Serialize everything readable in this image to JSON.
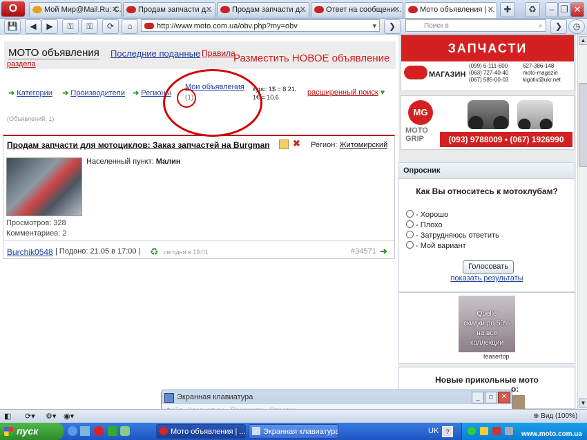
{
  "browser": {
    "tabs": [
      {
        "label": "Мой Мир@Mail.Ru: С..."
      },
      {
        "label": "Продам запчасти д..."
      },
      {
        "label": "Продам запчасти д..."
      },
      {
        "label": "Ответ на сообщени..."
      },
      {
        "label": "Мото объявления | ..."
      }
    ],
    "url": "http://www.moto.com.ua/obv.php?my=obv",
    "search_placeholder": "Поиск в",
    "zoom": "Вид (100%)"
  },
  "page": {
    "site_title": "МОТО объявления",
    "nav_recent": "Последние поданные",
    "nav_rules_1": "Правила",
    "nav_rules_2": "раздела",
    "post_new": "Разместить НОВОЕ объявление",
    "menu": {
      "categories": "Категории",
      "manufacturers": "Производители",
      "regions": "Регионы",
      "my_ads": "Мои объявления",
      "my_ads_count": "(1)",
      "rate": "курс: 1$ = 8.21,",
      "rate2": "1€ = 10.6",
      "advanced_search": "расширенный поиск"
    },
    "ads_count": "(Объявлений: 1)",
    "post": {
      "title": "Продам запчасти для мотоциклов: Заказ запчастей на Burgman",
      "region_label": "Регион:",
      "region": "Житомирский",
      "locality_label": "Населенный пункт:",
      "locality": "Малин",
      "views": "Просмотров: 328",
      "comments": "Комментариев: 2",
      "author": "Burchik0548",
      "submitted": "| Подано: 21.05 в 17:00 |",
      "updated": "сегодня в 19:01",
      "id": "#34571"
    },
    "banner1": {
      "heading": "ЗАПЧАСТИ",
      "shop": "МАГАЗИН",
      "phone1": "(099) 6-111-600",
      "phone2": "(063) 727-40-40",
      "phone3": "(067) 585-00-03",
      "icq": "627-386-148",
      "skype": "moto-magazin",
      "email": "kigotix@ukr.net"
    },
    "banner2": {
      "logo": "MG",
      "brand1": "MOTO",
      "brand2": "GRIP",
      "phones": "(093) 9788009 • (067) 1926990"
    },
    "poll": {
      "header": "Опросник",
      "question": "Как Вы относитесь к мотоклубам?",
      "options": [
        "- Хорошо",
        "- Плохо",
        "- Затрудняюсь ответить",
        "- Мой вариант"
      ],
      "vote": "Голосовать",
      "results": "показать результаты"
    },
    "teaser": {
      "lines": [
        "Quelle",
        "скидки до 50%",
        "на все",
        "коллекции"
      ],
      "brand": "teasertop"
    },
    "news_heading_1": "Новые прикольные мото",
    "news_heading_2": "о:"
  },
  "osk": {
    "title": "Экранная клавиатура",
    "menu": [
      "Файл",
      "Клавиатура",
      "Параметры",
      "Справка"
    ]
  },
  "taskbar": {
    "start": "пуск",
    "tasks": [
      "Мото объявления | ...",
      "Экранная клавиатура"
    ],
    "lang": "UK",
    "site": "www.moto.com.ua"
  }
}
